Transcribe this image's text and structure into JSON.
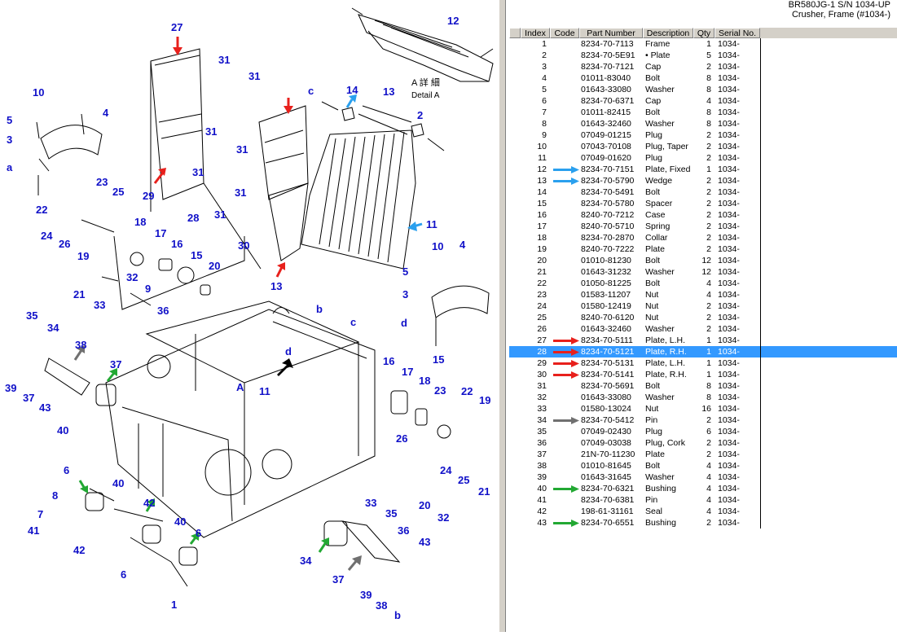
{
  "title_line1": "BR580JG-1 S/N 1034-UP",
  "title_line2": "Crusher, Frame (#1034-)",
  "columns": [
    "Index",
    "Code",
    "Part Number",
    "Description",
    "Qty",
    "Serial No."
  ],
  "colors": {
    "selected": "#3399ff",
    "red": "#e8201c",
    "blue": "#2aa0ee",
    "gray": "#707070",
    "green": "#22a833",
    "callout": "#1010c8"
  },
  "rows": [
    {
      "index": "1",
      "part": "8234-70-7113",
      "desc": "Frame",
      "qty": "1",
      "serial": "1034-",
      "arrow": ""
    },
    {
      "index": "2",
      "part": "8234-70-5E91",
      "desc": "• Plate",
      "qty": "5",
      "serial": "1034-",
      "arrow": ""
    },
    {
      "index": "3",
      "part": "8234-70-7121",
      "desc": "Cap",
      "qty": "2",
      "serial": "1034-",
      "arrow": ""
    },
    {
      "index": "4",
      "part": "01011-83040",
      "desc": "Bolt",
      "qty": "8",
      "serial": "1034-",
      "arrow": ""
    },
    {
      "index": "5",
      "part": "01643-33080",
      "desc": "Washer",
      "qty": "8",
      "serial": "1034-",
      "arrow": ""
    },
    {
      "index": "6",
      "part": "8234-70-6371",
      "desc": "Cap",
      "qty": "4",
      "serial": "1034-",
      "arrow": ""
    },
    {
      "index": "7",
      "part": "01011-82415",
      "desc": "Bolt",
      "qty": "8",
      "serial": "1034-",
      "arrow": ""
    },
    {
      "index": "8",
      "part": "01643-32460",
      "desc": "Washer",
      "qty": "8",
      "serial": "1034-",
      "arrow": ""
    },
    {
      "index": "9",
      "part": "07049-01215",
      "desc": "Plug",
      "qty": "2",
      "serial": "1034-",
      "arrow": ""
    },
    {
      "index": "10",
      "part": "07043-70108",
      "desc": "Plug, Taper",
      "qty": "2",
      "serial": "1034-",
      "arrow": ""
    },
    {
      "index": "11",
      "part": "07049-01620",
      "desc": "Plug",
      "qty": "2",
      "serial": "1034-",
      "arrow": ""
    },
    {
      "index": "12",
      "part": "8234-70-7151",
      "desc": "Plate, Fixed",
      "qty": "1",
      "serial": "1034-",
      "arrow": "blue"
    },
    {
      "index": "13",
      "part": "8234-70-5790",
      "desc": "Wedge",
      "qty": "2",
      "serial": "1034-",
      "arrow": "blue"
    },
    {
      "index": "14",
      "part": "8234-70-5491",
      "desc": "Bolt",
      "qty": "2",
      "serial": "1034-",
      "arrow": ""
    },
    {
      "index": "15",
      "part": "8234-70-5780",
      "desc": "Spacer",
      "qty": "2",
      "serial": "1034-",
      "arrow": ""
    },
    {
      "index": "16",
      "part": "8240-70-7212",
      "desc": "Case",
      "qty": "2",
      "serial": "1034-",
      "arrow": ""
    },
    {
      "index": "17",
      "part": "8240-70-5710",
      "desc": "Spring",
      "qty": "2",
      "serial": "1034-",
      "arrow": ""
    },
    {
      "index": "18",
      "part": "8234-70-2870",
      "desc": "Collar",
      "qty": "2",
      "serial": "1034-",
      "arrow": ""
    },
    {
      "index": "19",
      "part": "8240-70-7222",
      "desc": "Plate",
      "qty": "2",
      "serial": "1034-",
      "arrow": ""
    },
    {
      "index": "20",
      "part": "01010-81230",
      "desc": "Bolt",
      "qty": "12",
      "serial": "1034-",
      "arrow": ""
    },
    {
      "index": "21",
      "part": "01643-31232",
      "desc": "Washer",
      "qty": "12",
      "serial": "1034-",
      "arrow": ""
    },
    {
      "index": "22",
      "part": "01050-81225",
      "desc": "Bolt",
      "qty": "4",
      "serial": "1034-",
      "arrow": ""
    },
    {
      "index": "23",
      "part": "01583-11207",
      "desc": "Nut",
      "qty": "4",
      "serial": "1034-",
      "arrow": ""
    },
    {
      "index": "24",
      "part": "01580-12419",
      "desc": "Nut",
      "qty": "2",
      "serial": "1034-",
      "arrow": ""
    },
    {
      "index": "25",
      "part": "8240-70-6120",
      "desc": "Nut",
      "qty": "2",
      "serial": "1034-",
      "arrow": ""
    },
    {
      "index": "26",
      "part": "01643-32460",
      "desc": "Washer",
      "qty": "2",
      "serial": "1034-",
      "arrow": ""
    },
    {
      "index": "27",
      "part": "8234-70-5111",
      "desc": "Plate, L.H.",
      "qty": "1",
      "serial": "1034-",
      "arrow": "red"
    },
    {
      "index": "28",
      "part": "8234-70-5121",
      "desc": "Plate, R.H.",
      "qty": "1",
      "serial": "1034-",
      "arrow": "red",
      "selected": true
    },
    {
      "index": "29",
      "part": "8234-70-5131",
      "desc": "Plate, L.H.",
      "qty": "1",
      "serial": "1034-",
      "arrow": "red"
    },
    {
      "index": "30",
      "part": "8234-70-5141",
      "desc": "Plate, R.H.",
      "qty": "1",
      "serial": "1034-",
      "arrow": "red"
    },
    {
      "index": "31",
      "part": "8234-70-5691",
      "desc": "Bolt",
      "qty": "8",
      "serial": "1034-",
      "arrow": ""
    },
    {
      "index": "32",
      "part": "01643-33080",
      "desc": "Washer",
      "qty": "8",
      "serial": "1034-",
      "arrow": ""
    },
    {
      "index": "33",
      "part": "01580-13024",
      "desc": "Nut",
      "qty": "16",
      "serial": "1034-",
      "arrow": ""
    },
    {
      "index": "34",
      "part": "8234-70-5412",
      "desc": "Pin",
      "qty": "2",
      "serial": "1034-",
      "arrow": "gray"
    },
    {
      "index": "35",
      "part": "07049-02430",
      "desc": "Plug",
      "qty": "6",
      "serial": "1034-",
      "arrow": ""
    },
    {
      "index": "36",
      "part": "07049-03038",
      "desc": "Plug, Cork",
      "qty": "2",
      "serial": "1034-",
      "arrow": ""
    },
    {
      "index": "37",
      "part": "21N-70-11230",
      "desc": "Plate",
      "qty": "2",
      "serial": "1034-",
      "arrow": ""
    },
    {
      "index": "38",
      "part": "01010-81645",
      "desc": "Bolt",
      "qty": "4",
      "serial": "1034-",
      "arrow": ""
    },
    {
      "index": "39",
      "part": "01643-31645",
      "desc": "Washer",
      "qty": "4",
      "serial": "1034-",
      "arrow": ""
    },
    {
      "index": "40",
      "part": "8234-70-6321",
      "desc": "Bushing",
      "qty": "4",
      "serial": "1034-",
      "arrow": "green"
    },
    {
      "index": "41",
      "part": "8234-70-6381",
      "desc": "Pin",
      "qty": "4",
      "serial": "1034-",
      "arrow": ""
    },
    {
      "index": "42",
      "part": "198-61-31161",
      "desc": "Seal",
      "qty": "4",
      "serial": "1034-",
      "arrow": ""
    },
    {
      "index": "43",
      "part": "8234-70-6551",
      "desc": "Bushing",
      "qty": "2",
      "serial": "1034-",
      "arrow": "green"
    }
  ],
  "diagram": {
    "detail_label": "A 詳 細",
    "detail_label_en": "Detail A",
    "letters": [
      "a",
      "b",
      "c",
      "d",
      "A"
    ],
    "callouts": [
      "27",
      "31",
      "31",
      "31",
      "29",
      "31",
      "28",
      "31",
      "31",
      "31",
      "30",
      "13",
      "14",
      "13",
      "2",
      "12",
      "11",
      "10",
      "4",
      "5",
      "3",
      "a",
      "22",
      "23",
      "25",
      "24",
      "26",
      "19",
      "18",
      "17",
      "16",
      "15",
      "20",
      "21",
      "33",
      "32",
      "9",
      "36",
      "35",
      "34",
      "38",
      "39",
      "37",
      "43",
      "37",
      "40",
      "6",
      "8",
      "7",
      "41",
      "42",
      "40",
      "42",
      "40",
      "6",
      "6",
      "1",
      "c",
      "b",
      "d",
      "A",
      "11",
      "10",
      "4",
      "5",
      "3",
      "d",
      "15",
      "16",
      "17",
      "18",
      "23",
      "22",
      "19",
      "26",
      "24",
      "25",
      "21",
      "20",
      "32",
      "33",
      "35",
      "36",
      "43",
      "34",
      "37",
      "39",
      "38",
      "b",
      "c"
    ]
  }
}
